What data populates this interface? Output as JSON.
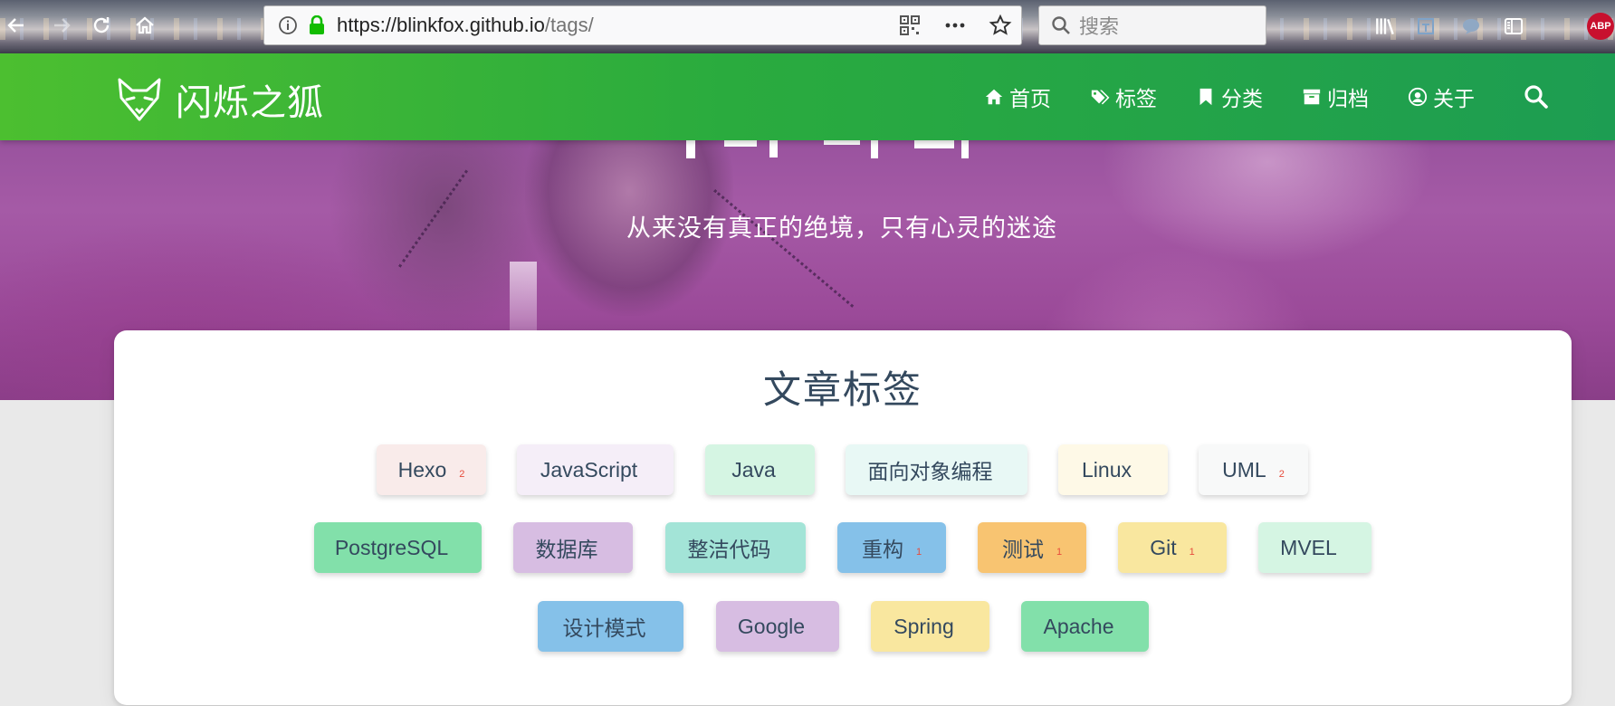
{
  "browser": {
    "url_host": "https://blinkfox.github.io",
    "url_path": "/tags/",
    "search_placeholder": "搜索",
    "abp_label": "ABP",
    "icons": [
      "back-icon",
      "forward-icon",
      "reload-icon",
      "home-icon",
      "info-icon",
      "lock-icon",
      "qr-code-icon",
      "more-icon",
      "star-icon",
      "search-icon",
      "library-icon",
      "extension-icon",
      "chat-icon",
      "sidebar-icon"
    ]
  },
  "site": {
    "brand": "闪烁之狐",
    "nav": [
      {
        "label": "首页",
        "icon": "home-icon"
      },
      {
        "label": "标签",
        "icon": "tags-icon"
      },
      {
        "label": "分类",
        "icon": "bookmark-icon"
      },
      {
        "label": "归档",
        "icon": "archive-icon"
      },
      {
        "label": "关于",
        "icon": "user-circle-icon"
      }
    ],
    "motto": "从来没有真正的绝境，只有心灵的迷途"
  },
  "tags_section": {
    "title": "文章标签",
    "rows": [
      [
        {
          "name": "Hexo",
          "count": "2",
          "color": "#f9ebea"
        },
        {
          "name": "JavaScript",
          "count": "",
          "color": "#f5eef8"
        },
        {
          "name": "Java",
          "count": "",
          "color": "#d5f5e3"
        },
        {
          "name": "面向对象编程",
          "count": "",
          "color": "#e8f8f5"
        },
        {
          "name": "Linux",
          "count": "",
          "color": "#fef9e7"
        },
        {
          "name": "UML",
          "count": "2",
          "color": "#f8f9f9"
        }
      ],
      [
        {
          "name": "PostgreSQL",
          "count": "",
          "color": "#82e0aa"
        },
        {
          "name": "数据库",
          "count": "",
          "color": "#d7bde2"
        },
        {
          "name": "整洁代码",
          "count": "",
          "color": "#a3e4d7"
        },
        {
          "name": "重构",
          "count": "1",
          "color": "#85c1e9"
        },
        {
          "name": "测试",
          "count": "1",
          "color": "#f8c471"
        },
        {
          "name": "Git",
          "count": "1",
          "color": "#f9e79f"
        },
        {
          "name": "MVEL",
          "count": "",
          "color": "#d5f5e3"
        }
      ],
      [
        {
          "name": "设计模式",
          "count": "",
          "color": "#85c1e9"
        },
        {
          "name": "Google",
          "count": "",
          "color": "#d7bde2"
        },
        {
          "name": "Spring",
          "count": "",
          "color": "#f9e79f"
        },
        {
          "name": "Apache",
          "count": "",
          "color": "#82e0aa"
        }
      ]
    ]
  },
  "colors": {
    "header_start": "#4cbf30",
    "header_end": "#1d9d52",
    "title_text": "#34495e",
    "count_text": "#e74c3c"
  }
}
